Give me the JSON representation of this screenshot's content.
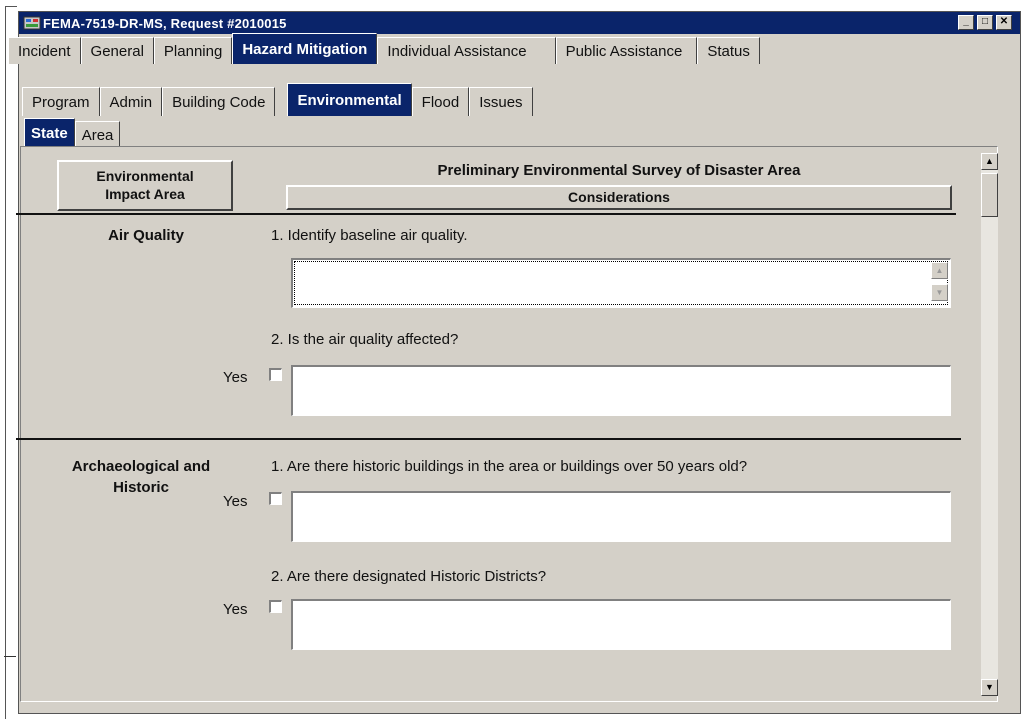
{
  "window": {
    "title": "FEMA-7519-DR-MS, Request #2010015",
    "controls": [
      "_",
      "□",
      "✕"
    ]
  },
  "tabs_main": [
    {
      "label": "Incident",
      "active": false
    },
    {
      "label": "General",
      "active": false
    },
    {
      "label": "Planning",
      "active": false
    },
    {
      "label": "Hazard Mitigation",
      "active": true
    },
    {
      "label": "Individual Assistance",
      "active": false
    },
    {
      "label": "Public Assistance",
      "active": false
    },
    {
      "label": "Status",
      "active": false
    }
  ],
  "tabs_sub": [
    {
      "label": "Program",
      "active": false
    },
    {
      "label": "Admin",
      "active": false
    },
    {
      "label": "Building Code",
      "active": false
    },
    {
      "label": "Environmental",
      "active": true
    },
    {
      "label": "Flood",
      "active": false
    },
    {
      "label": "Issues",
      "active": false
    }
  ],
  "tabs_scope": [
    {
      "label": "State",
      "active": true
    },
    {
      "label": "Area",
      "active": false
    }
  ],
  "form": {
    "column_button": "Environmental Impact Area",
    "heading": "Preliminary Environmental Survey of Disaster Area",
    "considerations_button": "Considerations",
    "sections": [
      {
        "area": "Air Quality",
        "questions": [
          {
            "text": "1. Identify baseline air quality.",
            "has_yes": false,
            "yes_label": "",
            "checked": false,
            "value": ""
          },
          {
            "text": "2. Is the air quality affected?",
            "has_yes": true,
            "yes_label": "Yes",
            "checked": false,
            "value": ""
          }
        ]
      },
      {
        "area": "Archaeological and Historic",
        "questions": [
          {
            "text": "1. Are there historic buildings in the area or buildings over 50 years old?",
            "has_yes": true,
            "yes_label": "Yes",
            "checked": false,
            "value": ""
          },
          {
            "text": "2. Are there designated Historic Districts?",
            "has_yes": true,
            "yes_label": "Yes",
            "checked": false,
            "value": ""
          }
        ]
      }
    ]
  }
}
